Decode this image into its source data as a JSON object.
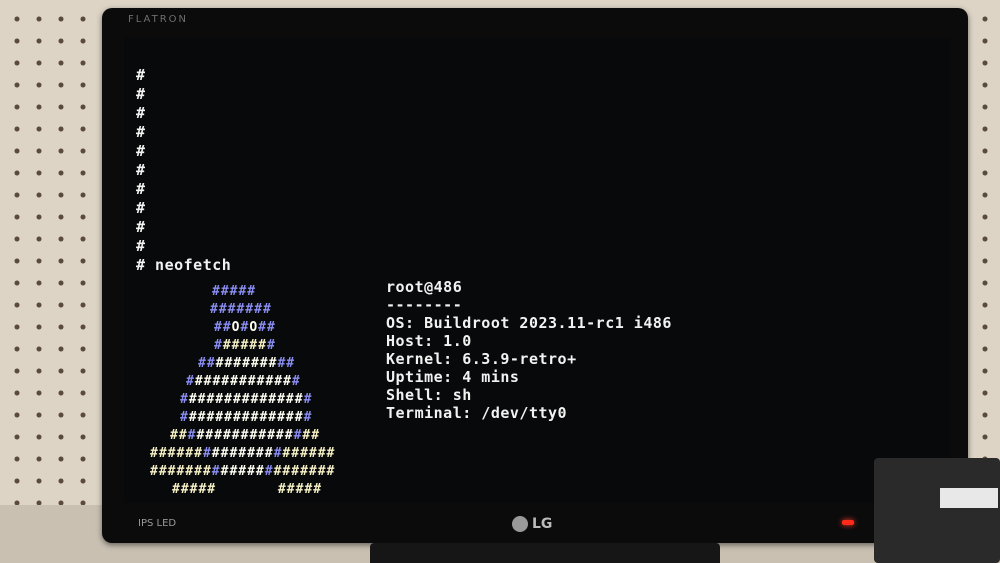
{
  "monitor": {
    "brand_top": "FLATRON",
    "ips_label": "IPS LED",
    "bezel_brand": "LG"
  },
  "terminal": {
    "prompt_lines": [
      "#",
      "#",
      "#",
      "#",
      "#",
      "#",
      "#",
      "#",
      "#",
      "#"
    ],
    "command": "# neofetch",
    "user_host": "root@486",
    "separator": "--------",
    "os": "OS: Buildroot 2023.11-rc1 i486",
    "host": "Host: 1.0",
    "kernel": "Kernel: 6.3.9-retro+",
    "uptime": "Uptime: 4 mins",
    "shell": "Shell: sh",
    "terminal": "Terminal: /dev/tty0"
  },
  "colors": {
    "screen_bg": "#08090a",
    "text": "#f2f2f2",
    "logo_blue": "#8a8df2",
    "logo_white": "#fdfdf2",
    "logo_yellow": "#f6f0c6"
  }
}
